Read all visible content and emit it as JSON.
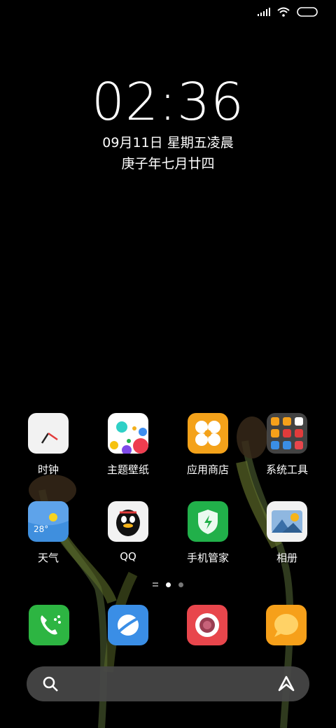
{
  "status_bar": {
    "icons": [
      "signal-icon",
      "wifi-icon",
      "battery-icon"
    ]
  },
  "lock": {
    "time": "02:36",
    "date": "09月11日 星期五凌晨",
    "lunar": "庚子年七月廿四"
  },
  "apps": [
    {
      "label": "时钟",
      "icon": "clock-icon"
    },
    {
      "label": "主题壁纸",
      "icon": "theme-icon"
    },
    {
      "label": "应用商店",
      "icon": "app-store-icon"
    },
    {
      "label": "系统工具",
      "icon": "folder-icon"
    },
    {
      "label": "天气",
      "icon": "weather-icon",
      "temp": "28°"
    },
    {
      "label": "QQ",
      "icon": "qq-icon"
    },
    {
      "label": "手机管家",
      "icon": "security-icon"
    },
    {
      "label": "相册",
      "icon": "gallery-icon"
    }
  ],
  "pager": {
    "pages": 3,
    "current": 2
  },
  "dock": [
    "phone-icon",
    "browser-icon",
    "camera-icon",
    "messages-icon"
  ],
  "search": {
    "icons": [
      "search-icon",
      "assistant-icon"
    ]
  },
  "colors": {
    "phone": "#2db542",
    "browser": "#3a8ee6",
    "camera": "#e8464c",
    "messages": "#f6a01a",
    "store": "#f4a21a",
    "security": "#21b04a",
    "weather": "#3f8fde"
  }
}
